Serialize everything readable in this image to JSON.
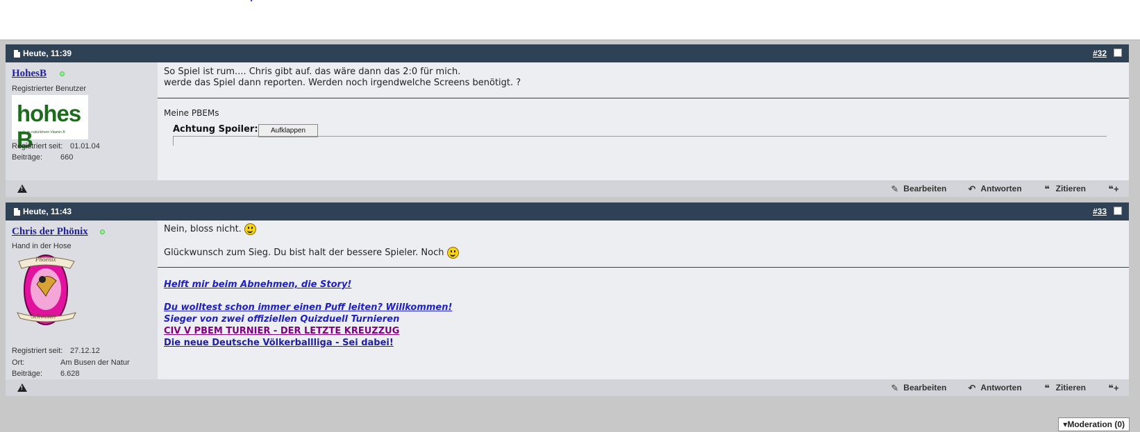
{
  "posts": [
    {
      "date": "Heute, 11:39",
      "number": "#32",
      "username": "HohesB",
      "usertitle": "Registrierter Benutzer",
      "avatar_text": "hohes B",
      "avatar_subtext": "reich an natürlichem Vitamin B",
      "stats": [
        {
          "label": "Registriert seit:",
          "value": "01.01.04"
        },
        {
          "label": "Beiträge:",
          "value": "660"
        }
      ],
      "message_lines": [
        "So Spiel ist rum.... Chris gibt auf. das wäre dann das 2:0 für mich.",
        "werde das Spiel dann reporten. Werden noch irgendwelche Screens benötigt. ?"
      ],
      "signature_title": "Meine PBEMs",
      "spoiler_label": "Achtung Spoiler",
      "spoiler_button": "Aufklappen"
    },
    {
      "date": "Heute, 11:43",
      "number": "#33",
      "username": "Chris der Phönix",
      "usertitle": "Hand in der Hose",
      "avatar_top": "Phoenix",
      "avatar_bottom": "Schwester",
      "stats": [
        {
          "label": "Registriert seit:",
          "value": "27.12.12"
        },
        {
          "label": "Ort:",
          "value": "Am Busen der Natur"
        },
        {
          "label": "Beiträge:",
          "value": "6.628"
        }
      ],
      "message_lines": [
        "Nein, bloss nicht.",
        "Glückwunsch zum Sieg. Du bist halt der bessere Spieler. Noch"
      ],
      "signature_links": [
        {
          "text": "Helft mir beim Abnehmen, die Story!",
          "color": "#2020c0",
          "style": "italic-underline"
        },
        {
          "text": "Du wolltest schon immer einen Puff leiten? Willkommen!",
          "color": "#2020c0",
          "style": "italic-underline"
        },
        {
          "text": "Sieger von zwei offiziellen Quizduell Turnieren",
          "color": "#2020c0",
          "style": "italic"
        },
        {
          "text": "CIV V PBEM TURNIER - DER LETZTE KREUZZUG",
          "color": "#800080",
          "style": "underline"
        },
        {
          "text": "Die neue Deutsche Völkerballliga - Sei dabei!",
          "color": "#2020a0",
          "style": "underline"
        }
      ]
    }
  ],
  "actions": {
    "edit": "Bearbeiten",
    "reply": "Antworten",
    "quote": "Zitieren"
  },
  "moderation": "Moderation (0)"
}
